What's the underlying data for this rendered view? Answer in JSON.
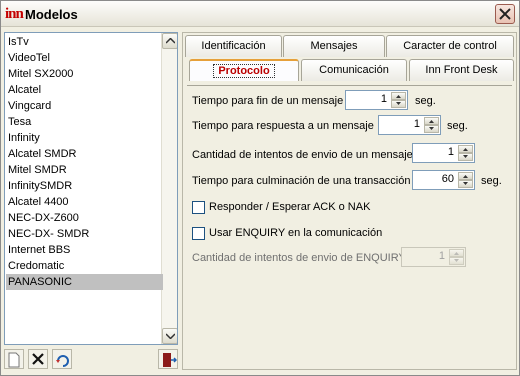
{
  "window": {
    "logo": "inn",
    "title": "Modelos"
  },
  "list": {
    "items": [
      "IsTv",
      "VideoTel",
      "Mitel SX2000",
      "Alcatel",
      "Vingcard",
      "Tesa",
      "Infinity",
      "Alcatel SMDR",
      "Mitel SMDR",
      "InfinitySMDR",
      "Alcatel 4400",
      "NEC-DX-Z600",
      "NEC-DX- SMDR",
      "Internet BBS",
      "Credomatic",
      "PANASONIC"
    ],
    "selected": "PANASONIC"
  },
  "tabs": {
    "row1": [
      "Identificación",
      "Mensajes",
      "Caracter de control"
    ],
    "row2": [
      "Protocolo",
      "Comunicación",
      "Inn Front Desk"
    ],
    "active": "Protocolo"
  },
  "form": {
    "fin_mensaje_label": "Tiempo para fin de un mensaje",
    "fin_mensaje_value": "1",
    "fin_mensaje_unit": "seg.",
    "respuesta_label": "Tiempo para respuesta a un mensaje",
    "respuesta_value": "1",
    "respuesta_unit": "seg.",
    "intentos_label": "Cantidad de intentos de envio de un mensaje",
    "intentos_value": "1",
    "culminacion_label": "Tiempo para culminación de una transacción",
    "culminacion_value": "60",
    "culminacion_unit": "seg.",
    "ack_label": "Responder / Esperar ACK o NAK",
    "ack_checked": false,
    "enquiry_label": "Usar ENQUIRY en la comunicación",
    "enquiry_checked": false,
    "intentos_enquiry_label": "Cantidad de intentos de envio de ENQUIRY",
    "intentos_enquiry_value": "1"
  },
  "icons": {
    "new": "new-document-icon",
    "delete": "delete-x-icon",
    "refresh": "refresh-icon",
    "exit": "exit-door-icon",
    "close": "close-icon"
  },
  "colors": {
    "accent_tab": "#e6a03a",
    "active_tab_text": "#bb0000",
    "close_button": "#e9c2b3"
  }
}
